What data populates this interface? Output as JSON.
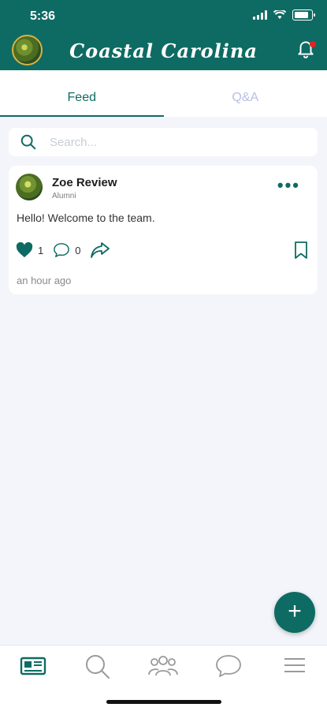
{
  "status_bar": {
    "time": "5:36"
  },
  "header": {
    "brand": "Coastal Carolina"
  },
  "tabs": [
    {
      "label": "Feed"
    },
    {
      "label": "Q&A"
    }
  ],
  "search": {
    "placeholder": "Search..."
  },
  "post": {
    "author": "Zoe Review",
    "role": "Alumni",
    "text": "Hello! Welcome to the team.",
    "likes": "1",
    "comments": "0",
    "time": "an hour ago"
  },
  "fab": {
    "label": "+"
  },
  "bottom_nav": [
    "newspaper-icon",
    "search-icon",
    "people-icon",
    "chat-icon",
    "menu-icon"
  ],
  "colors": {
    "primary": "#0e6b63",
    "notification": "#e32222",
    "tab_inactive": "#b7bfe6"
  }
}
